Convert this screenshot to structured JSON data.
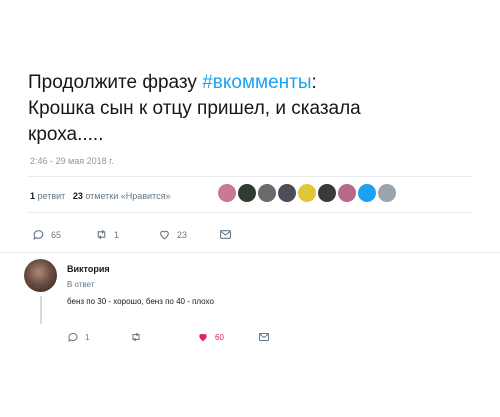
{
  "tweet": {
    "line1_prefix": "Продолжите фразу ",
    "hashtag": "#вкомменты",
    "line1_suffix": ":",
    "line2": "Крошка сын к отцу пришел, и сказала",
    "line3": "кроха.....",
    "timestamp": "2:46 - 29 мая 2018 г."
  },
  "stats": {
    "retweets_count": "1",
    "retweets_label": "ретвит",
    "likes_count": "23",
    "likes_label": "отметки «Нравится»"
  },
  "liker_avatar_colors": [
    "#c97a92",
    "#2f3b33",
    "#6a6a6a",
    "#4a4f57",
    "#e2c63a",
    "#3a3a3a",
    "#b56a8a",
    "#1da1f2",
    "#9aa4ad"
  ],
  "actions": {
    "reply_count": "65",
    "retweet_count": "1",
    "like_count": "23"
  },
  "reply": {
    "author": "Виктория",
    "context": "В ответ",
    "text": "бенз по 30 - хорошо, бенз по 40 - плохо",
    "reply_count": "1",
    "like_count": "60"
  },
  "colors": {
    "accent": "#1da1f2",
    "like_active": "#e0245e",
    "muted": "#657786"
  }
}
